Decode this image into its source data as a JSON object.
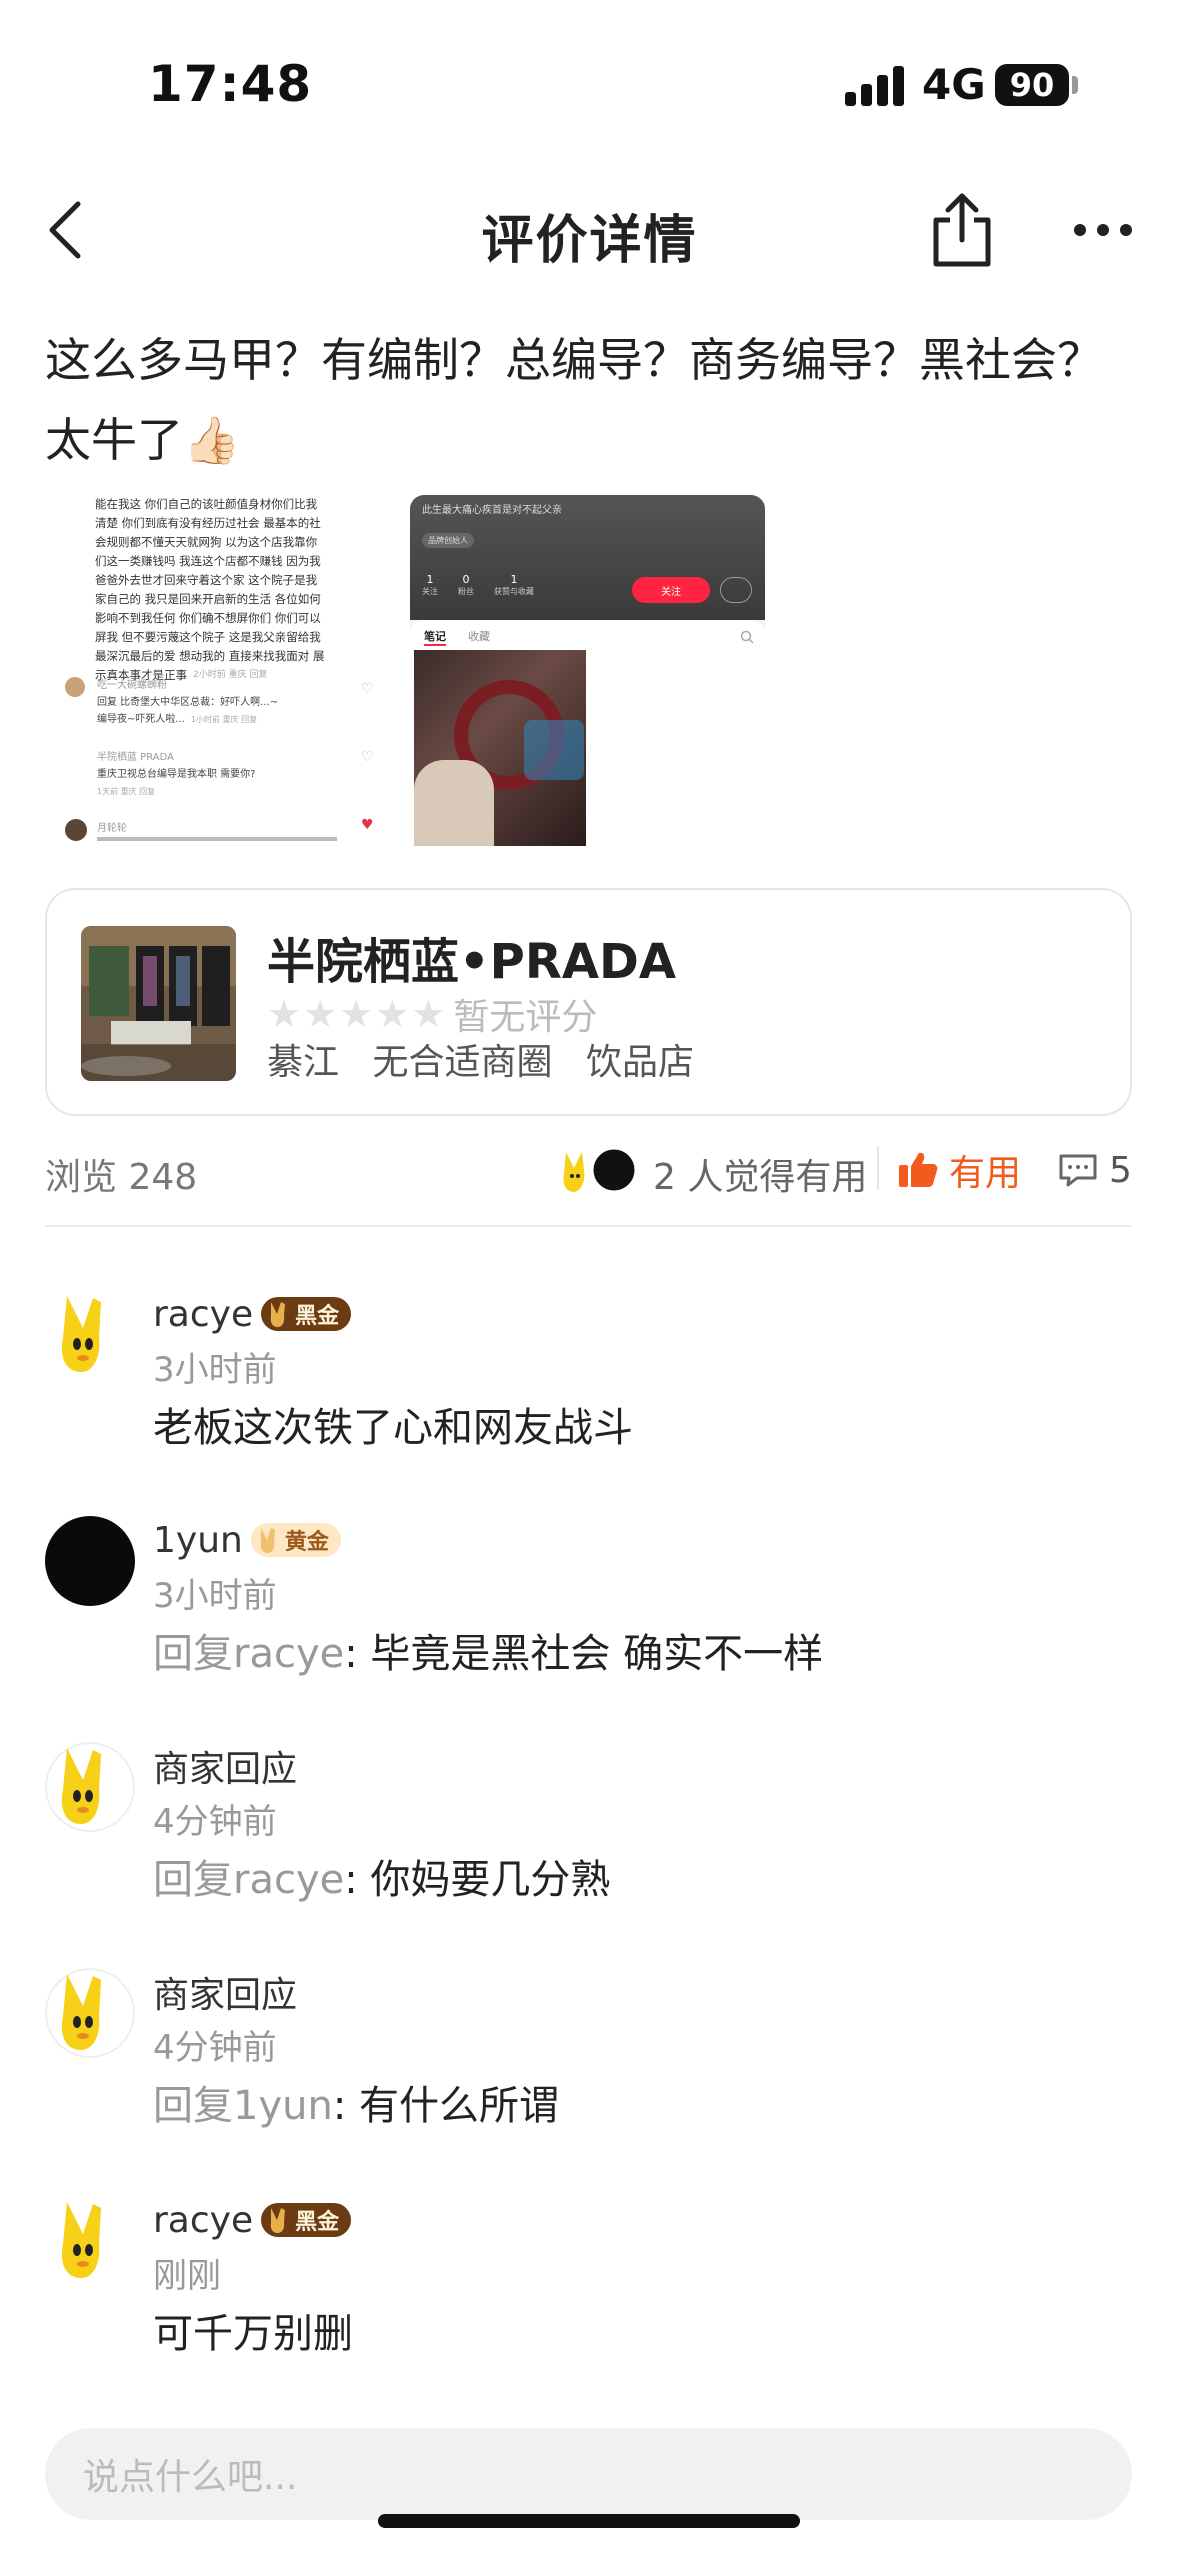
{
  "status_bar": {
    "time": "17:48",
    "network": "4G",
    "battery": "90"
  },
  "nav": {
    "title": "评价详情"
  },
  "review": {
    "text": "这么多马甲？有编制？总编导？商务编导？黑社会？太牛了👍🏻"
  },
  "screenshot_left": {
    "lines": [
      "能在我这 你们自己的该吐颜值身材你们比我",
      "清楚 你们到底有没有经历过社会 最基本的社",
      "会规则都不懂天天就网狗 以为这个店我靠你",
      "们这一类赚钱吗 我连这个店都不赚钱 因为我",
      "爸爸外去世才回来守着这个家 这个院子是我",
      "家自己的 我只是回来开启新的生活 各位如何",
      "影响不到我任何 你们确不想屏你们 你们可以",
      "屏我 但不要污蔑这个院子 这是我父亲留给我",
      "最深沉最后的爱 想动我的 直接来找我面对 展",
      "示真本事才是正事"
    ],
    "meta1": "2小时前 重庆 回复",
    "c1_name": "吃一大碗螺蛳粉",
    "c1_text": "回复 比奇堡大中华区总裁：好吓人啊...~",
    "c1_text2": "编导夜~吓死人啦...",
    "c1_meta": "1小时前 重庆 回复",
    "c2_name": "半院栖蓝 PRADA",
    "c2_text": "重庆卫视总台编导是我本职 需要你?",
    "c2_meta": "1天前 重庆 回复",
    "c3_name": "月轮轮"
  },
  "screenshot_right": {
    "header_text": "此生最大痛心疾首是对不起父亲",
    "tag": "品牌创始人",
    "stats": [
      {
        "num": "1",
        "label": "关注"
      },
      {
        "num": "0",
        "label": "粉丝"
      },
      {
        "num": "1",
        "label": "获赞与收藏"
      }
    ],
    "follow": "关注",
    "tabs": [
      "笔记",
      "收藏"
    ]
  },
  "shop": {
    "name": "半院栖蓝•PRADA",
    "rating_stars": "★★★★★",
    "rating_text": "暂无评分",
    "district": "綦江",
    "circle": "无合适商圈",
    "category": "饮品店"
  },
  "stats": {
    "views": "浏览 248",
    "useful_count": "2 人觉得有用",
    "useful_label": "有用",
    "comment_count": "5"
  },
  "comments": [
    {
      "name": "racye",
      "badge": "黑金",
      "badge_type": "black",
      "time": "3小时前",
      "reply_prefix": "",
      "text": "老板这次铁了心和网友战斗"
    },
    {
      "name": "1yun",
      "badge": "黄金",
      "badge_type": "gold",
      "time": "3小时前",
      "reply_prefix": "回复racye",
      "text": ": 毕竟是黑社会 确实不一样"
    },
    {
      "name": "商家回应",
      "badge": "",
      "badge_type": "",
      "time": "4分钟前",
      "reply_prefix": "回复racye",
      "text": ": 你妈要几分熟"
    },
    {
      "name": "商家回应",
      "badge": "",
      "badge_type": "",
      "time": "4分钟前",
      "reply_prefix": "回复1yun",
      "text": ": 有什么所谓"
    },
    {
      "name": "racye",
      "badge": "黑金",
      "badge_type": "black",
      "time": "刚刚",
      "reply_prefix": "",
      "text": "可千万别删"
    }
  ],
  "input": {
    "placeholder": "说点什么吧..."
  },
  "colors": {
    "accent": "#f25b1b",
    "badge_black": "#6b3b14",
    "badge_gold": "#fde7c4"
  }
}
